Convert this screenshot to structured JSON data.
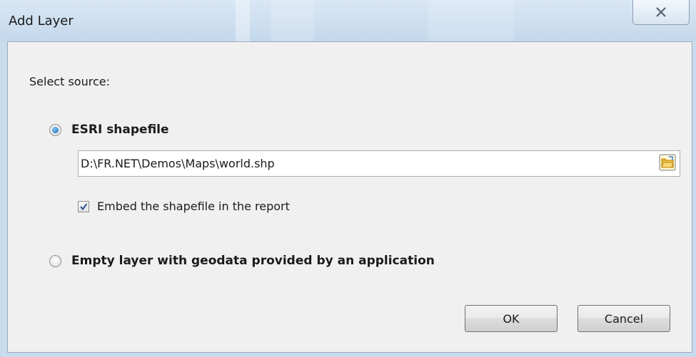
{
  "window": {
    "title": "Add Layer",
    "close_icon": "close-icon"
  },
  "dialog": {
    "prompt": "Select source:",
    "options": [
      {
        "label": "ESRI shapefile",
        "selected": true
      },
      {
        "label": "Empty layer with geodata provided by an application",
        "selected": false
      }
    ],
    "path_value": "D:\\FR.NET\\Demos\\Maps\\world.shp",
    "browse_icon": "folder-icon",
    "embed_label": "Embed the shapefile in the report",
    "embed_checked": true
  },
  "buttons": {
    "ok": "OK",
    "cancel": "Cancel"
  },
  "colors": {
    "frame": "#c9dcee",
    "client": "#f0f0f0",
    "radio_dot": "#1a5fa8"
  }
}
